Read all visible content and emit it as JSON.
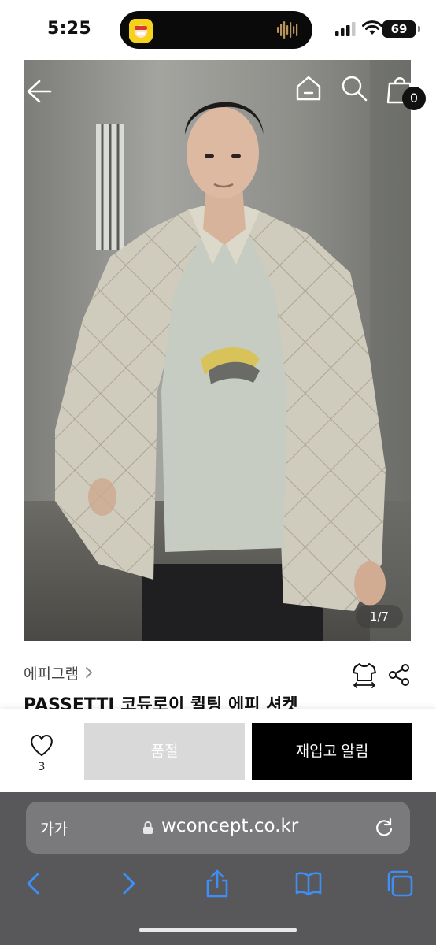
{
  "status_bar": {
    "time": "5:25",
    "battery": "69"
  },
  "hero": {
    "page_indicator": "1/7",
    "cart_count": "0"
  },
  "product": {
    "brand": "에피그램",
    "title": "PASSETTI 코듀로이 퀼팅 에피 셔켓"
  },
  "actions": {
    "like_count": "3",
    "soldout_label": "품절",
    "restock_label": "재입고 알림"
  },
  "browser": {
    "text_size_label": "가가",
    "url": "wconcept.co.kr"
  },
  "colors": {
    "accent": "#000000",
    "soldout_bg": "#d9d9d9",
    "safari_bg": "#58585a",
    "ios_blue": "#3d8ef7"
  },
  "icons": [
    "back-arrow-icon",
    "home-icon",
    "search-icon",
    "cart-icon",
    "chevron-right-icon",
    "hanger-fit-icon",
    "share-icon",
    "heart-icon",
    "lock-icon",
    "reload-icon",
    "safari-back-icon",
    "safari-forward-icon",
    "share-upload-icon",
    "bookmarks-icon",
    "tabs-icon"
  ]
}
